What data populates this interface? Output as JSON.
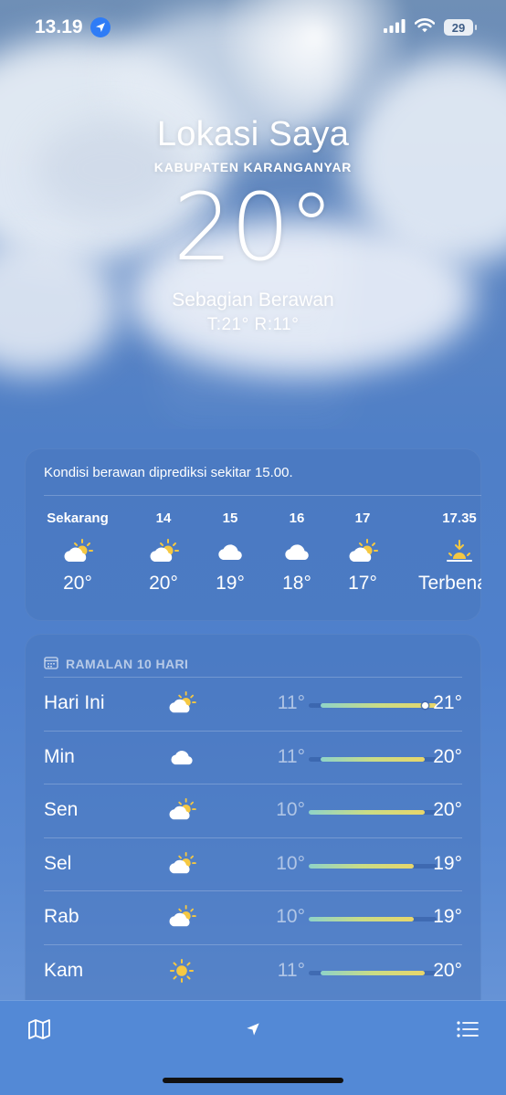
{
  "status_bar": {
    "time": "13.19",
    "battery": "29",
    "icons": [
      "location-arrow-icon",
      "cellular-signal-icon",
      "wifi-icon",
      "battery-icon"
    ]
  },
  "header": {
    "location": "Lokasi Saya",
    "region": "KABUPATEN KARANGANYAR",
    "temperature": "20°",
    "condition": "Sebagian Berawan",
    "hi_lo": "T:21°  R:11°"
  },
  "hourly": {
    "description": "Kondisi berawan diprediksi sekitar 15.00.",
    "items": [
      {
        "label": "Sekarang",
        "icon": "partly-cloudy-icon",
        "temp": "20°"
      },
      {
        "label": "14",
        "icon": "partly-cloudy-icon",
        "temp": "20°"
      },
      {
        "label": "15",
        "icon": "cloud-icon",
        "temp": "19°"
      },
      {
        "label": "16",
        "icon": "cloud-icon",
        "temp": "18°"
      },
      {
        "label": "17",
        "icon": "partly-cloudy-icon",
        "temp": "17°"
      },
      {
        "label": "17.35",
        "icon": "sunset-icon",
        "temp": "Terbenam"
      }
    ]
  },
  "daily": {
    "title": "RAMALAN 10 HARI",
    "scale_min": 10,
    "scale_max": 21,
    "days": [
      {
        "name": "Hari Ini",
        "icon": "partly-cloudy-icon",
        "low": "11°",
        "high": "21°",
        "low_val": 11,
        "high_val": 21,
        "current": 20
      },
      {
        "name": "Min",
        "icon": "cloud-icon",
        "low": "11°",
        "high": "20°",
        "low_val": 11,
        "high_val": 20
      },
      {
        "name": "Sen",
        "icon": "partly-cloudy-icon",
        "low": "10°",
        "high": "20°",
        "low_val": 10,
        "high_val": 20
      },
      {
        "name": "Sel",
        "icon": "partly-cloudy-icon",
        "low": "10°",
        "high": "19°",
        "low_val": 10,
        "high_val": 19
      },
      {
        "name": "Rab",
        "icon": "partly-cloudy-icon",
        "low": "10°",
        "high": "19°",
        "low_val": 10,
        "high_val": 19
      },
      {
        "name": "Kam",
        "icon": "sun-icon",
        "low": "11°",
        "high": "20°",
        "low_val": 11,
        "high_val": 20
      }
    ]
  },
  "toolbar": {
    "icons": [
      "map-icon",
      "location-arrow-icon",
      "list-icon"
    ]
  }
}
